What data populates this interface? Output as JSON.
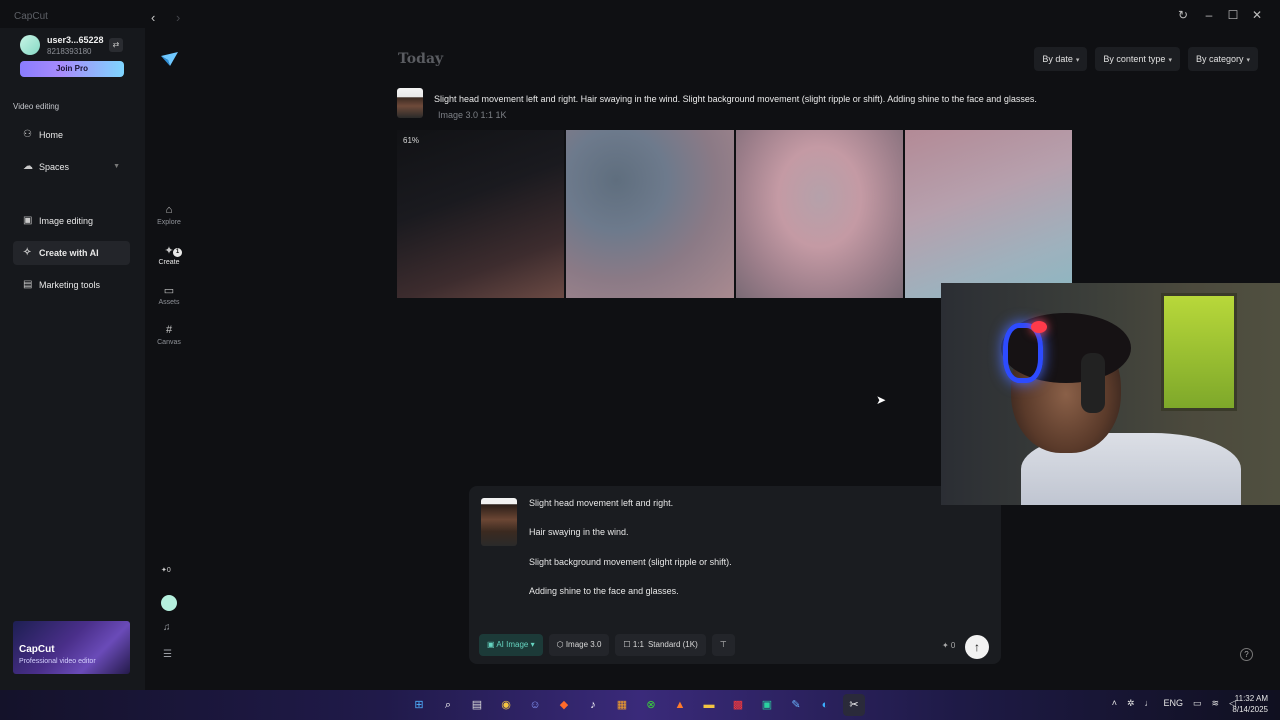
{
  "app": {
    "title": "CapCut",
    "nav_back": "‹",
    "nav_forward": "›",
    "window_controls": {
      "refresh": "↻",
      "minimize": "–",
      "maximize": "☐",
      "close": "✕"
    }
  },
  "sidebar": {
    "user_name": "user3...65228",
    "user_id": "8218393180",
    "switch_icon": "⇄",
    "join_pro": "Join Pro",
    "section_label": "Video editing",
    "items": [
      {
        "label": "Home",
        "icon": "⚇"
      },
      {
        "label": "Spaces",
        "icon": "☁"
      },
      {
        "label": "Image editing",
        "icon": "▣"
      },
      {
        "label": "Create with AI",
        "icon": "✧"
      },
      {
        "label": "Marketing tools",
        "icon": "▤"
      }
    ],
    "promo": {
      "title": "CapCut",
      "subtitle": "Professional video editor"
    }
  },
  "rail": {
    "items": [
      {
        "label": "Explore",
        "icon": "⌂"
      },
      {
        "label": "Create",
        "icon": "✦",
        "badge": "1"
      },
      {
        "label": "Assets",
        "icon": "▭"
      },
      {
        "label": "Canvas",
        "icon": "#"
      }
    ],
    "credits": "✦0",
    "bell_icon": "♫",
    "menu_icon": "☰"
  },
  "main": {
    "heading": "Today",
    "filters": [
      "By date",
      "By content type",
      "By category"
    ],
    "generation": {
      "prompt": "Slight head movement left and right. Hair swaying in the wind. Slight background movement (slight ripple or shift). Adding shine to the face and glasses.",
      "meta": "Image 3.0   1:1   1K",
      "progress_label": "61%",
      "progress": 0.61
    }
  },
  "composer": {
    "lines": [
      "Slight head movement left and right.",
      "Hair swaying in the wind.",
      "Slight background movement (slight ripple or shift).",
      "Adding shine to the face and glasses."
    ],
    "toolbar": {
      "mode": "AI Image",
      "model": "Image 3.0",
      "ratio": "1:1",
      "quality": "Standard (1K)",
      "credits": "✦ 0",
      "send_icon": "↑"
    },
    "help_icon": "?"
  },
  "taskbar": {
    "icons": [
      "windows-start-icon",
      "search-icon",
      "file-icon",
      "chrome-icon",
      "discord-icon",
      "brave-icon",
      "tiktok-icon",
      "store-icon",
      "xbox-icon",
      "app-icon",
      "folder-icon",
      "app-red-icon",
      "terminal-icon",
      "paint-icon",
      "edge-icon",
      "capcut-icon"
    ],
    "tray": [
      "ENG"
    ],
    "time": "11:32 AM",
    "date": "8/14/2025"
  }
}
